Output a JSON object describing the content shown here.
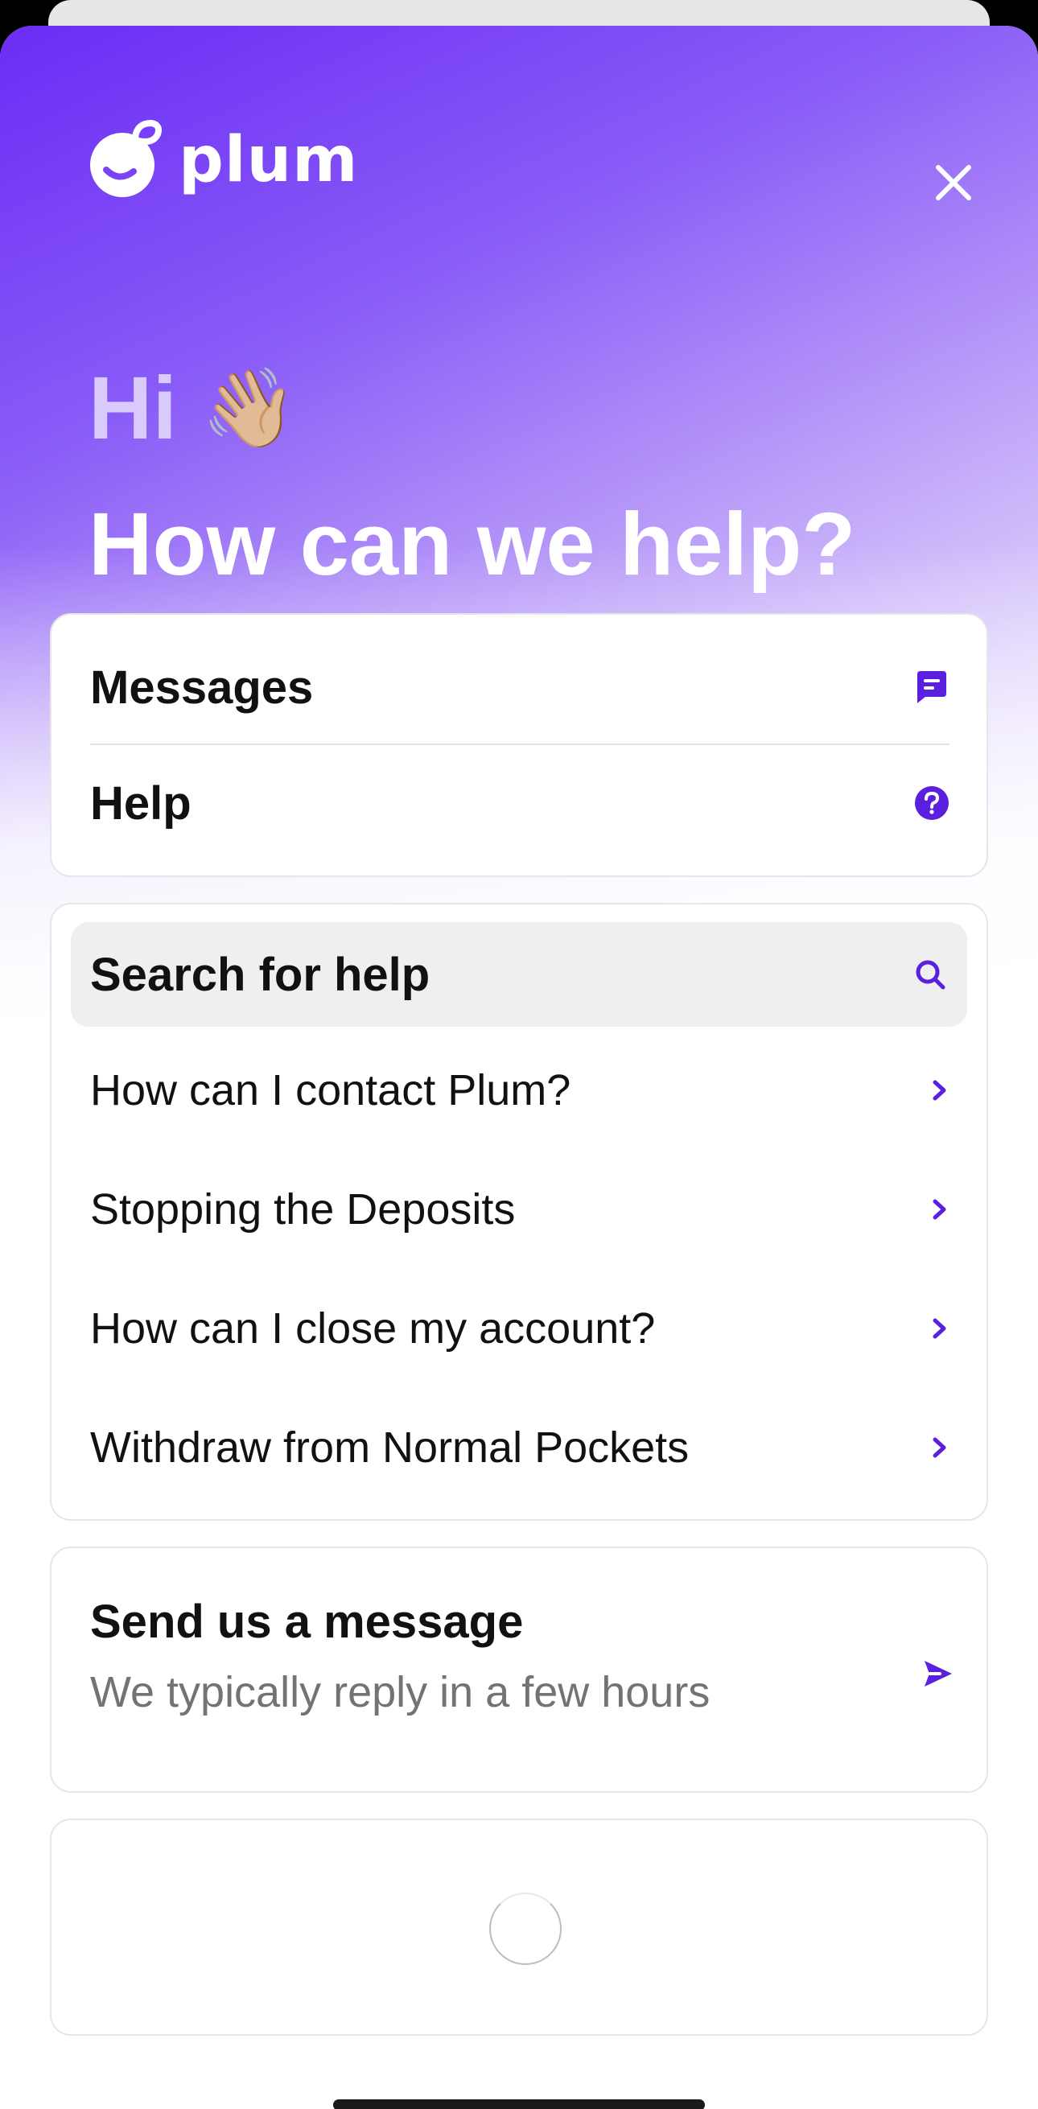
{
  "brand": {
    "name": "plum",
    "accent_color": "#5b1fe0"
  },
  "header": {
    "close_icon": "close-icon"
  },
  "greeting": {
    "hi": "Hi",
    "wave_emoji": "👋🏼",
    "headline": "How can we help?"
  },
  "nav": {
    "messages_label": "Messages",
    "messages_icon": "chat-bubble-icon",
    "help_label": "Help",
    "help_icon": "question-circle-icon"
  },
  "help": {
    "search_label": "Search for help",
    "search_icon": "search-icon",
    "articles": [
      {
        "label": "How can I contact Plum?"
      },
      {
        "label": "Stopping the Deposits"
      },
      {
        "label": "How can I close my account?"
      },
      {
        "label": "Withdraw from Normal Pockets"
      }
    ]
  },
  "message": {
    "title": "Send us a message",
    "subtitle": "We typically reply in a few hours",
    "icon": "send-icon"
  }
}
